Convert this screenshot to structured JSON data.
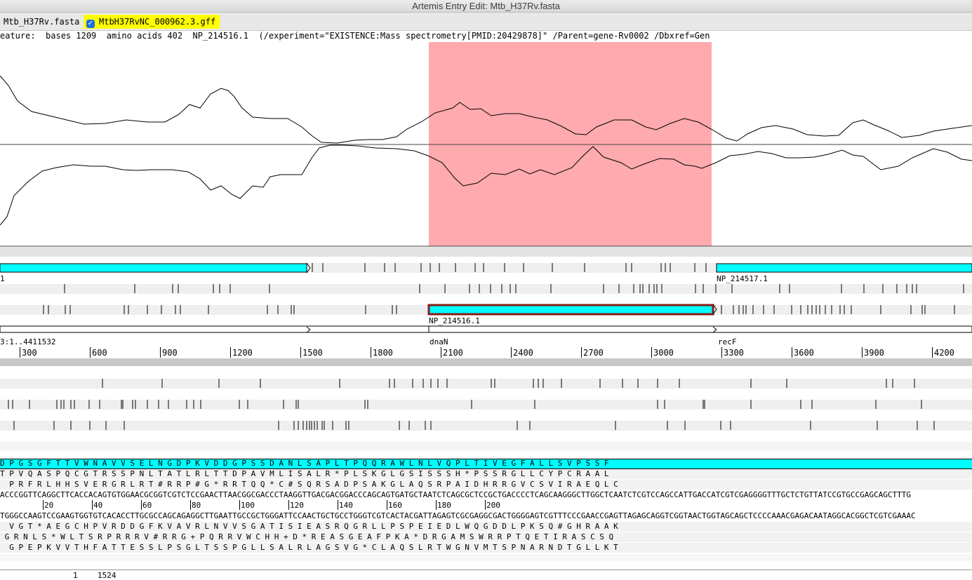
{
  "window": {
    "title": "Artemis Entry Edit: Mtb_H37Rv.fasta"
  },
  "entries": [
    {
      "label": "Mtb_H37Rv.fasta",
      "selected": false
    },
    {
      "label": "MtbH37RvNC_000962.3.gff",
      "selected": true,
      "checked": true
    }
  ],
  "selected_feature_line": "eature:  bases 1209  amino acids 402  NP_214516.1  (/experiment=\"EXISTENCE:Mass spectrometry[PMID:20429878]\" /Parent=gene-Rv0002 /Dbxref=Gen",
  "graph": {
    "highlight_color": "#ffaaae"
  },
  "features": {
    "gene_label_left": "1",
    "label_np_214517": "NP_214517.1",
    "label_np_214516": "NP_214516.1",
    "feature_color": "#00ffff",
    "selected_border": "#8b1a1a"
  },
  "forward_axis": {
    "source_label": "3:1..4411532",
    "gene_labels": [
      "dnaN",
      "recF"
    ],
    "ticks": [
      "300",
      "600",
      "900",
      "1200",
      "1500",
      "1800",
      "2100",
      "2400",
      "2700",
      "3000",
      "3300",
      "3600",
      "3900",
      "4200"
    ]
  },
  "sequence": {
    "aa_highlight": "D P G S G F T T V W N A V V S E L N G D P K V D D G P S S D A N L S A P L T P Q Q R A W L N L V Q P L T I V E G F A L L S V P S S F",
    "aa_fwd2": "T P V Q A S P Q C G T R S S P N L T A T L R L T T D P A V M L I S A L R * P L S K G L G S I S S S H * P S S R G L L C Y P C R A A L",
    "aa_fwd3": "  P R F R L H H S V E R G R L R T # R R P # G * R R T Q Q * C # S Q R S A D P S A K G L A Q S R P A I D H R R G V C S V I R A E Q L C",
    "dna_fwd": "ACCCGGTTCAGGCTTCACCACAGTGTGGAACGCGGTCGTCTCCGAACTTAACGGCGACCCTAAGGTTGACGACGGACCCAGCAGTGATGCTAATCTCAGCGCTCCGCTGACCCCTCAGCAAGGGCTTGGCTCAATCTCGTCCAGCCATTGACCATCGTCGAGGGGTTTGCTCTGTTATCCGTGCCGAGCAGCTTTG",
    "positions": [
      "20",
      "40",
      "60",
      "80",
      "100",
      "120",
      "140",
      "160",
      "180",
      "200"
    ],
    "dna_rev": "TGGGCCAAGTCCGAAGTGGTGTCACACCTTGCGCCAGCAGAGGCTTGAATTGCCGCTGGGATTCCAACTGCTGCCTGGGTCGTCACTACGATTAGAGTCGCGAGGCGACTGGGGAGTCGTTTCCCGAACCGAGTTAGAGCAGGTCGGTAACTGGTAGCAGCTCCCCAAACGAGACAATAGGCACGGCTCGTCGAAAC",
    "aa_rev1": "  V G T * A E G C H P V R D D G F K V A V R L N V V S G A T I S I E A S R Q G R L L P S P E I E D L W Q G D D L P K S Q # G H R A A K",
    "aa_rev2": " G R N L S * W L T S R P R R R V # R R G + P Q R R V W C H H + D * R E A S G E A F P K A * D R G A M S W R R P T Q E T I R A S C S Q",
    "aa_rev3": "  G P E P K V V T H F A T T E S S L P S G L T S S P G L L S A L R L A G S V G * C L A Q S L R T W G N V M T S P N A R N D T G L L K T"
  },
  "status": {
    "start": "1",
    "end": "1524"
  }
}
